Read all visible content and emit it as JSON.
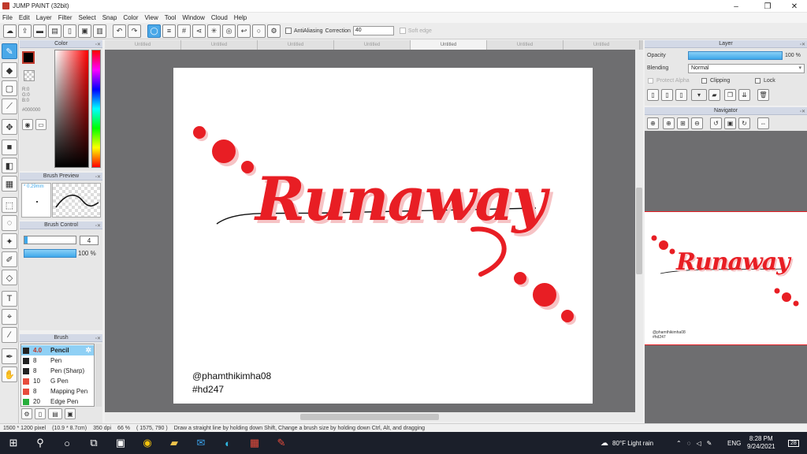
{
  "window": {
    "title": "JUMP PAINT (32bit)",
    "minimize": "–",
    "restore": "❐",
    "close": "✕"
  },
  "menu": [
    "File",
    "Edit",
    "Layer",
    "Filter",
    "Select",
    "Snap",
    "Color",
    "View",
    "Tool",
    "Window",
    "Cloud",
    "Help"
  ],
  "toolbar": {
    "antialiasing_label": "AntiAliasing",
    "correction_label": "Correction",
    "correction_value": "40",
    "soft_edge_label": "Soft edge"
  },
  "color_panel": {
    "title": "Color",
    "r": "R:0",
    "g": "G:0",
    "b": "B:0",
    "hex": "#000000",
    "colors": {
      "foreground": "#000000",
      "accent": "#4aa8e8"
    }
  },
  "brush_preview": {
    "title": "Brush Preview",
    "size_label": "* 0.29mm"
  },
  "brush_control": {
    "title": "Brush Control",
    "size_value": "4",
    "opacity_value": "100 %"
  },
  "brush_panel": {
    "title": "Brush",
    "items": [
      {
        "size": "4.0",
        "name": "Pencil",
        "color": "#222222",
        "selected": true
      },
      {
        "size": "8",
        "name": "Pen",
        "color": "#222222"
      },
      {
        "size": "8",
        "name": "Pen (Sharp)",
        "color": "#222222"
      },
      {
        "size": "10",
        "name": "G Pen",
        "color": "#e74c3c"
      },
      {
        "size": "8",
        "name": "Mapping Pen",
        "color": "#e74c3c"
      },
      {
        "size": "20",
        "name": "Edge Pen",
        "color": "#27ae3c"
      }
    ]
  },
  "tabs": [
    "Untitled",
    "Untitled",
    "Untitled",
    "Untitled",
    "Untitled",
    "Untitled",
    "Untitled"
  ],
  "canvas": {
    "artwork_text": "Runaway",
    "credit_line1": "@phamthikimha08",
    "credit_line2": "#hd247",
    "accent_color": "#e81e24"
  },
  "layer_panel": {
    "title": "Layer",
    "opacity_label": "Opacity",
    "opacity_value": "100 %",
    "opacity_fraction": 1.0,
    "blending_label": "Blending",
    "blending_value": "Normal",
    "protect_alpha_label": "Protect Alpha",
    "clipping_label": "Clipping",
    "lock_label": "Lock"
  },
  "navigator_panel": {
    "title": "Navigator",
    "preview_credit1": "@phamthikimha08",
    "preview_credit2": "#hd247"
  },
  "status": {
    "size": "1500 * 1200 pixel",
    "physical": "(10.9 * 8.7cm)",
    "dpi": "350 dpi",
    "zoom": "66 %",
    "cursor": "( 1575, 790 )",
    "hint": "Draw a straight line by holding down Shift, Change a brush size by holding down Ctrl, Alt, and dragging"
  },
  "taskbar": {
    "weather": "80°F  Light rain",
    "lang": "ENG",
    "time": "8:28 PM",
    "date": "9/24/2021",
    "notifications": "28"
  }
}
